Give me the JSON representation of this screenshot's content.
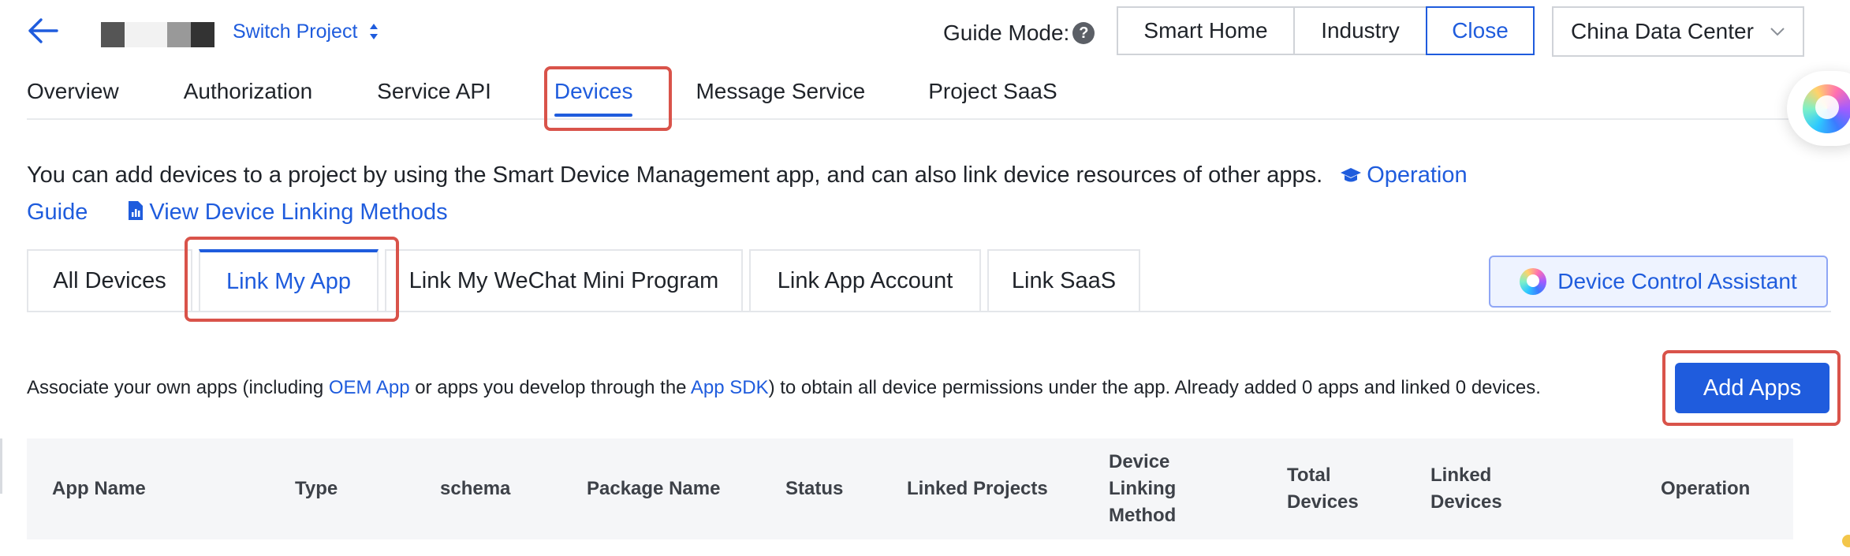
{
  "header": {
    "switch_project": "Switch Project",
    "guide_mode_label": "Guide Mode:",
    "help_glyph": "?",
    "guide_buttons": [
      "Smart Home",
      "Industry",
      "Close"
    ],
    "data_center": "China Data Center"
  },
  "nav": {
    "tabs": [
      "Overview",
      "Authorization",
      "Service API",
      "Devices",
      "Message Service",
      "Project SaaS"
    ],
    "active": "Devices"
  },
  "description": {
    "text": "You can add devices to a project by using the Smart Device Management app, and can also link device resources of other apps.",
    "operation_guide_part1": "Operation",
    "operation_guide_part2": "Guide",
    "view_linking": "View Device Linking Methods"
  },
  "subtabs": {
    "items": [
      "All Devices",
      "Link My App",
      "Link My WeChat Mini Program",
      "Link App Account",
      "Link SaaS"
    ],
    "active": "Link My App"
  },
  "device_control_assistant": "Device Control Assistant",
  "associate": {
    "part1": "Associate your own apps (including ",
    "oem_link": "OEM App",
    "part2": " or apps you develop through the ",
    "sdk_link": "App SDK",
    "part3": ") to obtain all device permissions under the app. Already added 0 apps and linked 0 devices."
  },
  "add_apps": "Add Apps",
  "table": {
    "columns": [
      [
        "App Name"
      ],
      [
        "Type"
      ],
      [
        "schema"
      ],
      [
        "Package Name"
      ],
      [
        "Status"
      ],
      [
        "Linked Projects"
      ],
      [
        "Device",
        "Linking",
        "Method"
      ],
      [
        "Total",
        "Devices"
      ],
      [
        "Linked",
        "Devices"
      ],
      [
        "Operation"
      ]
    ]
  },
  "colors": {
    "accent": "#1f5cdd",
    "highlight_box": "#d9534a"
  }
}
